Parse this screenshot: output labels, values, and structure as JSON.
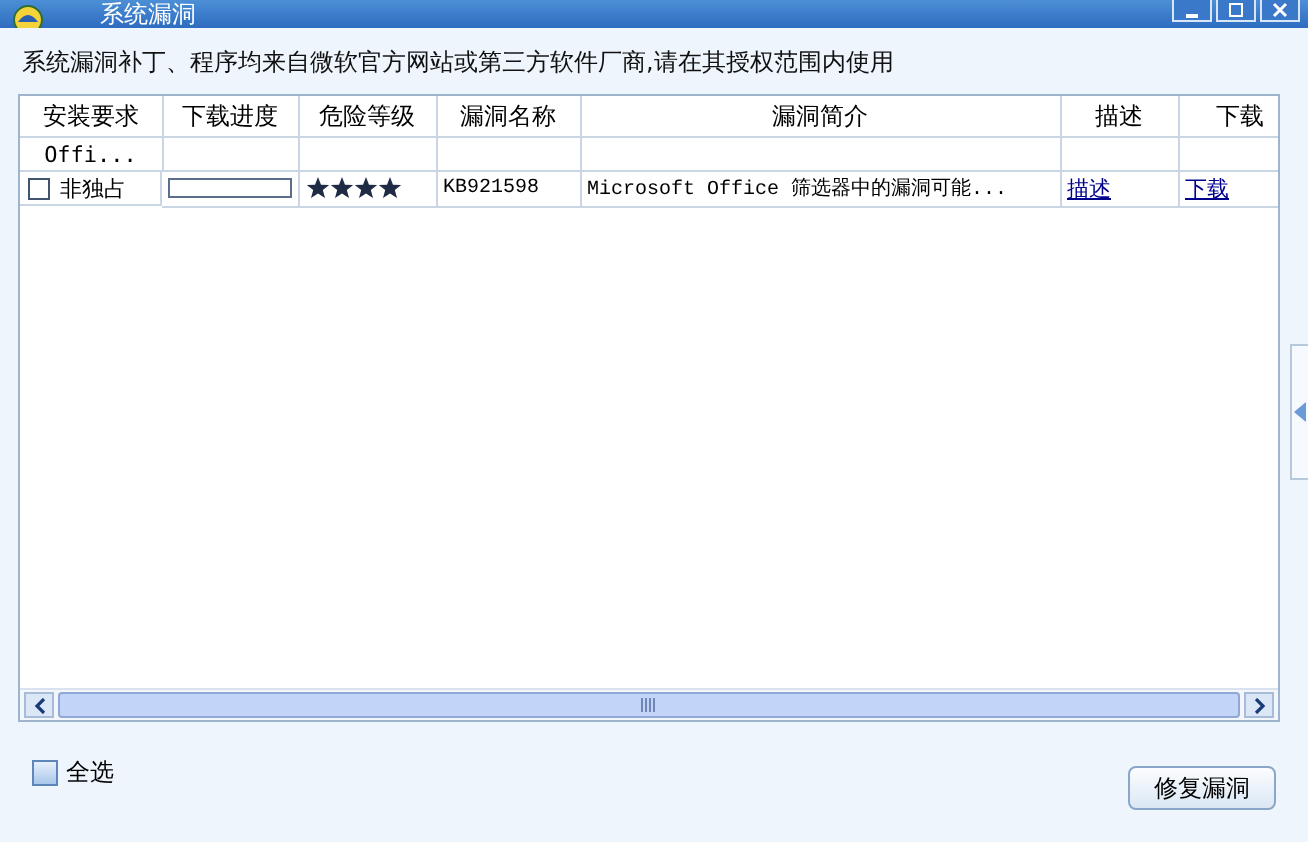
{
  "window": {
    "title": "系统漏洞"
  },
  "notice": "系统漏洞补丁、程序均来自微软官方网站或第三方软件厂商,请在其授权范围内使用",
  "table": {
    "columns": [
      "安装要求",
      "下载进度",
      "危险等级",
      "漏洞名称",
      "漏洞简介",
      "描述",
      "下载"
    ],
    "rows": [
      {
        "kind": "group",
        "label": "Offi..."
      },
      {
        "kind": "item",
        "checked": false,
        "requirement": "非独占",
        "level": 0,
        "stars": 4,
        "name": "KB921598",
        "summary": "Microsoft Office 筛选器中的漏洞可能...",
        "describe": "描述",
        "download": "下载"
      }
    ]
  },
  "select_all": {
    "label": "全选",
    "checked": false
  },
  "buttons": [
    "修复漏洞"
  ]
}
